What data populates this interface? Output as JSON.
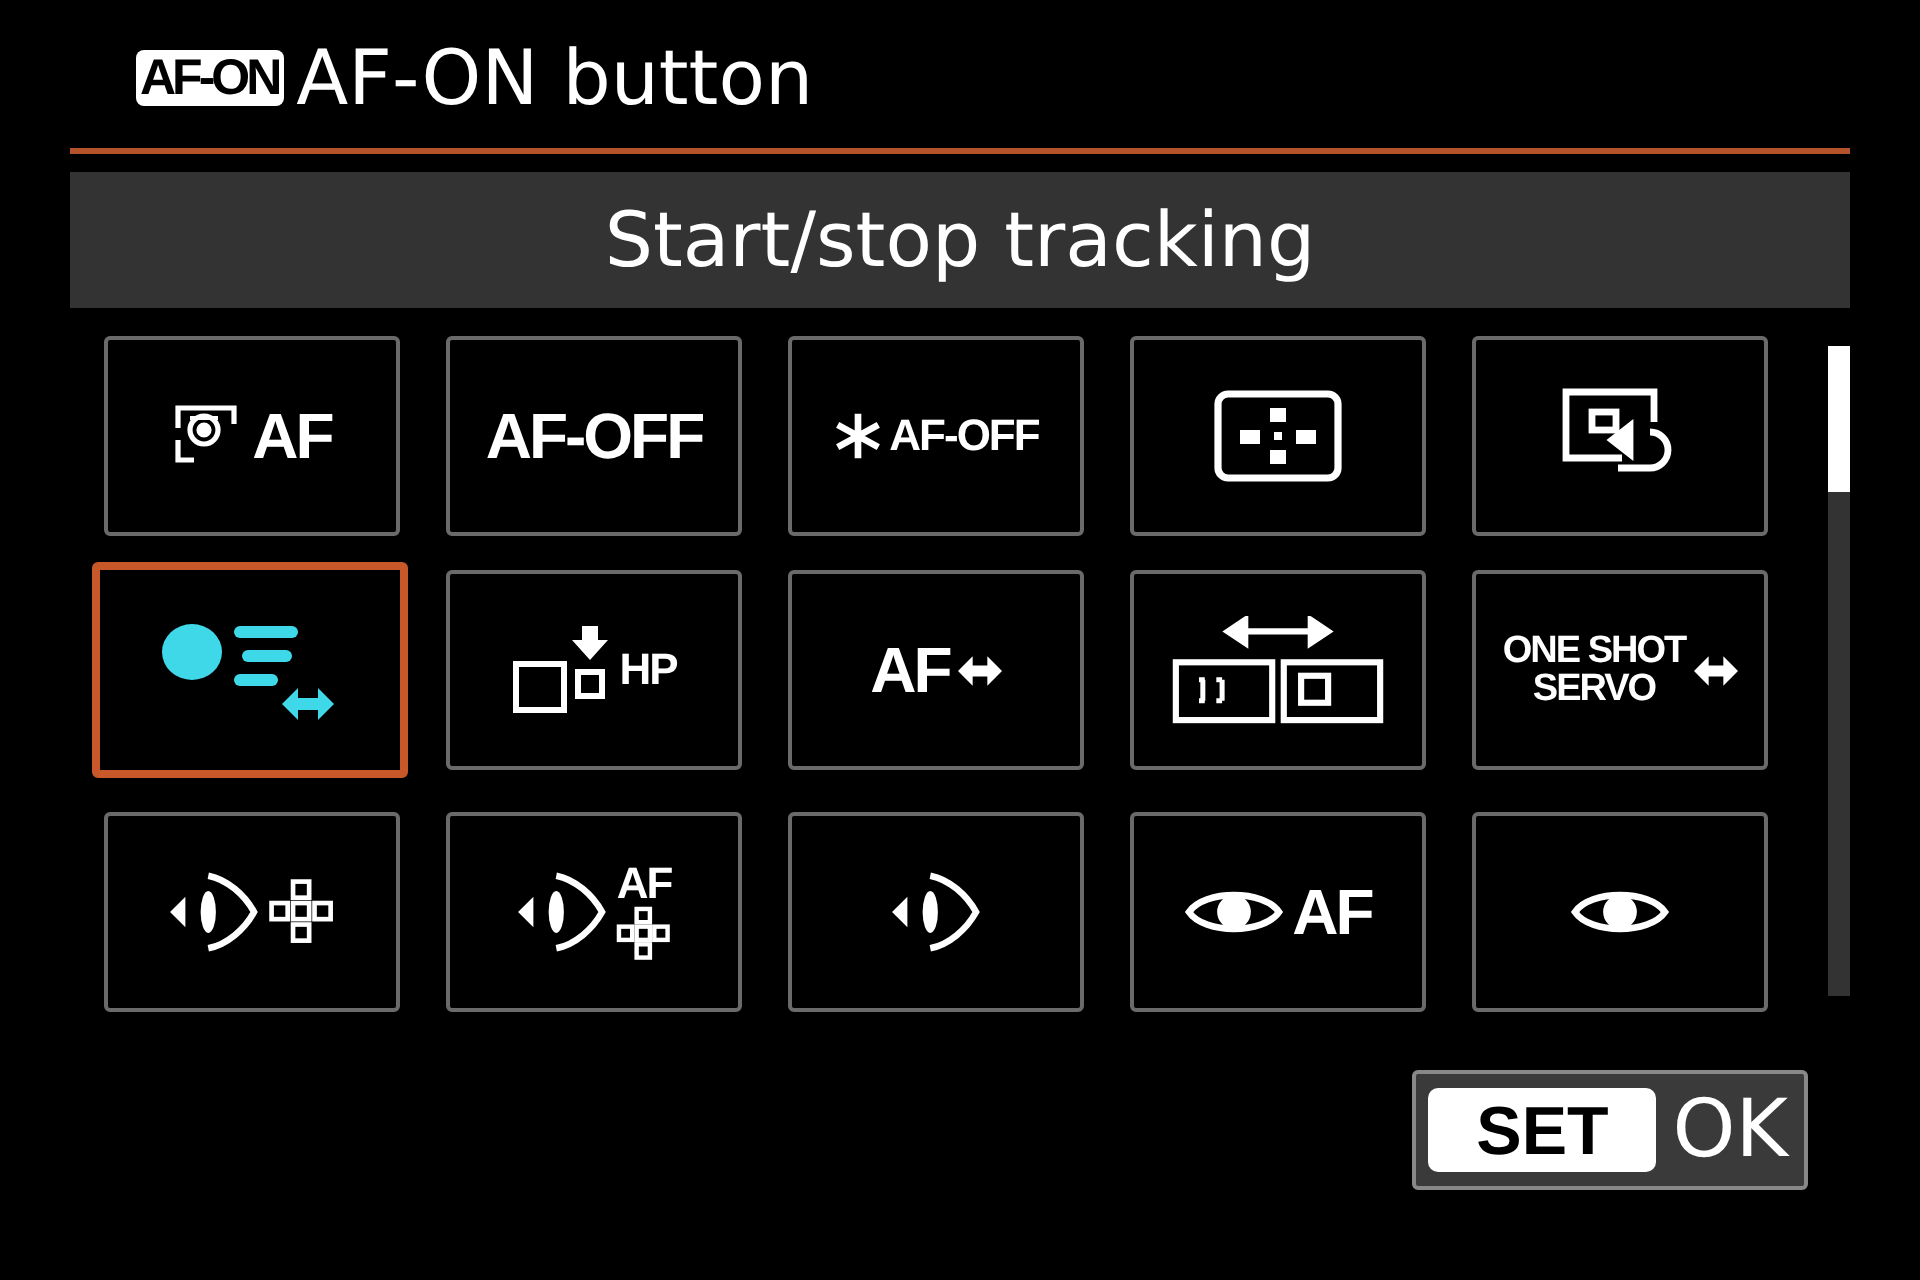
{
  "header": {
    "badge": "AF-ON",
    "title": "AF-ON button"
  },
  "description": "Start/stop tracking",
  "options": [
    {
      "kind": "face-af",
      "texts": [
        "AF"
      ],
      "selected": false
    },
    {
      "kind": "text",
      "texts": [
        "AF-OFF"
      ],
      "selected": false
    },
    {
      "kind": "star-text",
      "texts": [
        "AF-OFF"
      ],
      "selected": false
    },
    {
      "kind": "af-point",
      "selected": false
    },
    {
      "kind": "frame-return",
      "selected": false
    },
    {
      "kind": "tracking",
      "selected": true
    },
    {
      "kind": "home-position",
      "texts": [
        "HP"
      ],
      "selected": false
    },
    {
      "kind": "af-switch",
      "texts": [
        "AF"
      ],
      "selected": false
    },
    {
      "kind": "area-switch",
      "selected": false
    },
    {
      "kind": "mode-switch",
      "texts": [
        "ONE SHOT",
        "SERVO"
      ],
      "selected": false
    },
    {
      "kind": "eye-points",
      "selected": false
    },
    {
      "kind": "eye-af-points",
      "texts": [
        "AF"
      ],
      "selected": false
    },
    {
      "kind": "eye",
      "selected": false
    },
    {
      "kind": "eye-detect-af",
      "texts": [
        "AF"
      ],
      "selected": false
    },
    {
      "kind": "eye-detect",
      "selected": false
    }
  ],
  "confirm": {
    "key": "SET",
    "label": "OK"
  }
}
